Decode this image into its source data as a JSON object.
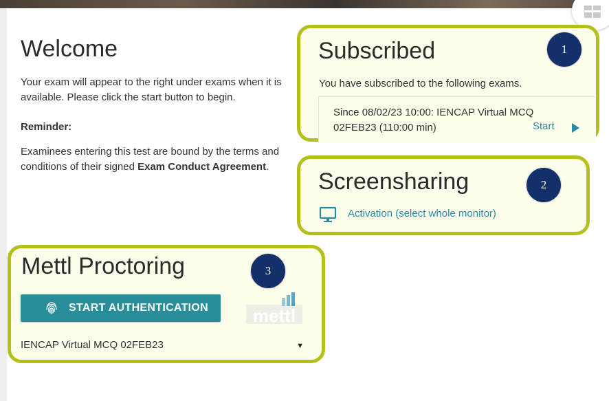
{
  "welcome": {
    "title": "Welcome",
    "paragraph": "Your exam will appear to the right under exams when it is available. Please click the start button to begin.",
    "reminder_label": "Reminder:",
    "terms_prefix": "Examinees entering this test are bound by the terms and conditions of their signed ",
    "terms_bold": "Exam Conduct Agreement",
    "terms_suffix": "."
  },
  "subscribed": {
    "title": "Subscribed",
    "description": "You have subscribed to the following exams.",
    "exam_entry": "Since 08/02/23 10:00: IENCAP Virtual MCQ 02FEB23 (110:00 min)",
    "start_label": "Start"
  },
  "screensharing": {
    "title": "Screensharing",
    "activation_label": "Activation (select whole monitor)"
  },
  "proctoring": {
    "title": "Mettl Proctoring",
    "auth_button_label": "START AUTHENTICATION",
    "logo_text": "mettl",
    "selected_exam": "IENCAP Virtual MCQ 02FEB23"
  },
  "annotations": [
    "1",
    "2",
    "3"
  ],
  "colors": {
    "highlight_border": "#b5bf1a",
    "card_background": "#fdfdec",
    "link": "#2a8a9e",
    "button": "#2a8d9a",
    "badge": "#13306b"
  },
  "icons": [
    "grid-icon",
    "play-icon",
    "monitor-icon",
    "fingerprint-icon",
    "dropdown-caret-icon"
  ]
}
